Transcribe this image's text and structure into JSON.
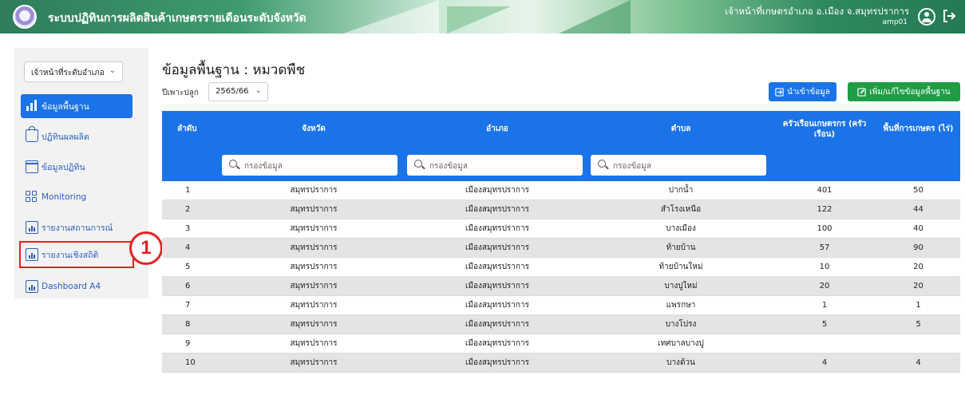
{
  "header": {
    "app_title": "ระบบปฏิทินการผลิตสินค้าเกษตรรายเดือนระดับจังหวัด",
    "user_role": "เจ้าหน้าที่เกษตรอำเภอ อ.เมือง จ.สมุทรปราการ",
    "user_id": "amp01"
  },
  "sidebar": {
    "level_select": "เจ้าหน้าที่ระดับอำเภอ",
    "items": [
      {
        "label": "ข้อมูลพื้นฐาน",
        "icon": "bar-chart-icon"
      },
      {
        "label": "ปฏิทินผลผลิต",
        "icon": "basket-icon"
      },
      {
        "label": "ข้อมูลปฏิทิน",
        "icon": "calendar-icon"
      },
      {
        "label": "Monitoring",
        "icon": "grid-icon"
      },
      {
        "label": "รายงานสถานการณ์",
        "icon": "report-icon"
      },
      {
        "label": "รายงานเชิงสถิติ",
        "icon": "report-icon"
      },
      {
        "label": "Dashboard A4",
        "icon": "report-icon"
      }
    ]
  },
  "annotation": {
    "marker": "1"
  },
  "main": {
    "title": "ข้อมูลพื้นฐาน : หมวดพืช",
    "season_label": "ปีเพาะปลูก",
    "season_value": "2565/66",
    "import_button": "นำเข้าข้อมูล",
    "edit_button": "เพิ่ม/แก้ไขข้อมูลพื้นฐาน"
  },
  "table": {
    "headers": [
      "ลำดับ",
      "จังหวัด",
      "อำเภอ",
      "ตำบล",
      "ครัวเรือนเกษตรกร (ครัวเรือน)",
      "พื้นที่การเกษตร (ไร่)"
    ],
    "filter_placeholder": "กรองข้อมูล",
    "rows": [
      [
        "1",
        "สมุทรปราการ",
        "เมืองสมุทรปราการ",
        "ปากน้ำ",
        "401",
        "50"
      ],
      [
        "2",
        "สมุทรปราการ",
        "เมืองสมุทรปราการ",
        "สำโรงเหนือ",
        "122",
        "44"
      ],
      [
        "3",
        "สมุทรปราการ",
        "เมืองสมุทรปราการ",
        "บางเมือง",
        "100",
        "40"
      ],
      [
        "4",
        "สมุทรปราการ",
        "เมืองสมุทรปราการ",
        "ท้ายบ้าน",
        "57",
        "90"
      ],
      [
        "5",
        "สมุทรปราการ",
        "เมืองสมุทรปราการ",
        "ท้ายบ้านใหม่",
        "10",
        "20"
      ],
      [
        "6",
        "สมุทรปราการ",
        "เมืองสมุทรปราการ",
        "บางปูใหม่",
        "20",
        "20"
      ],
      [
        "7",
        "สมุทรปราการ",
        "เมืองสมุทรปราการ",
        "แพรกษา",
        "1",
        "1"
      ],
      [
        "8",
        "สมุทรปราการ",
        "เมืองสมุทรปราการ",
        "บางโปรง",
        "5",
        "5"
      ],
      [
        "9",
        "สมุทรปราการ",
        "เมืองสมุทรปราการ",
        "เทศบาลบางปู",
        "",
        ""
      ],
      [
        "10",
        "สมุทรปราการ",
        "เมืองสมุทรปราการ",
        "บางด้วน",
        "4",
        "4"
      ]
    ]
  },
  "colors": {
    "primary": "#1a73e8",
    "success": "#1f9d45",
    "highlight": "#e52020"
  }
}
